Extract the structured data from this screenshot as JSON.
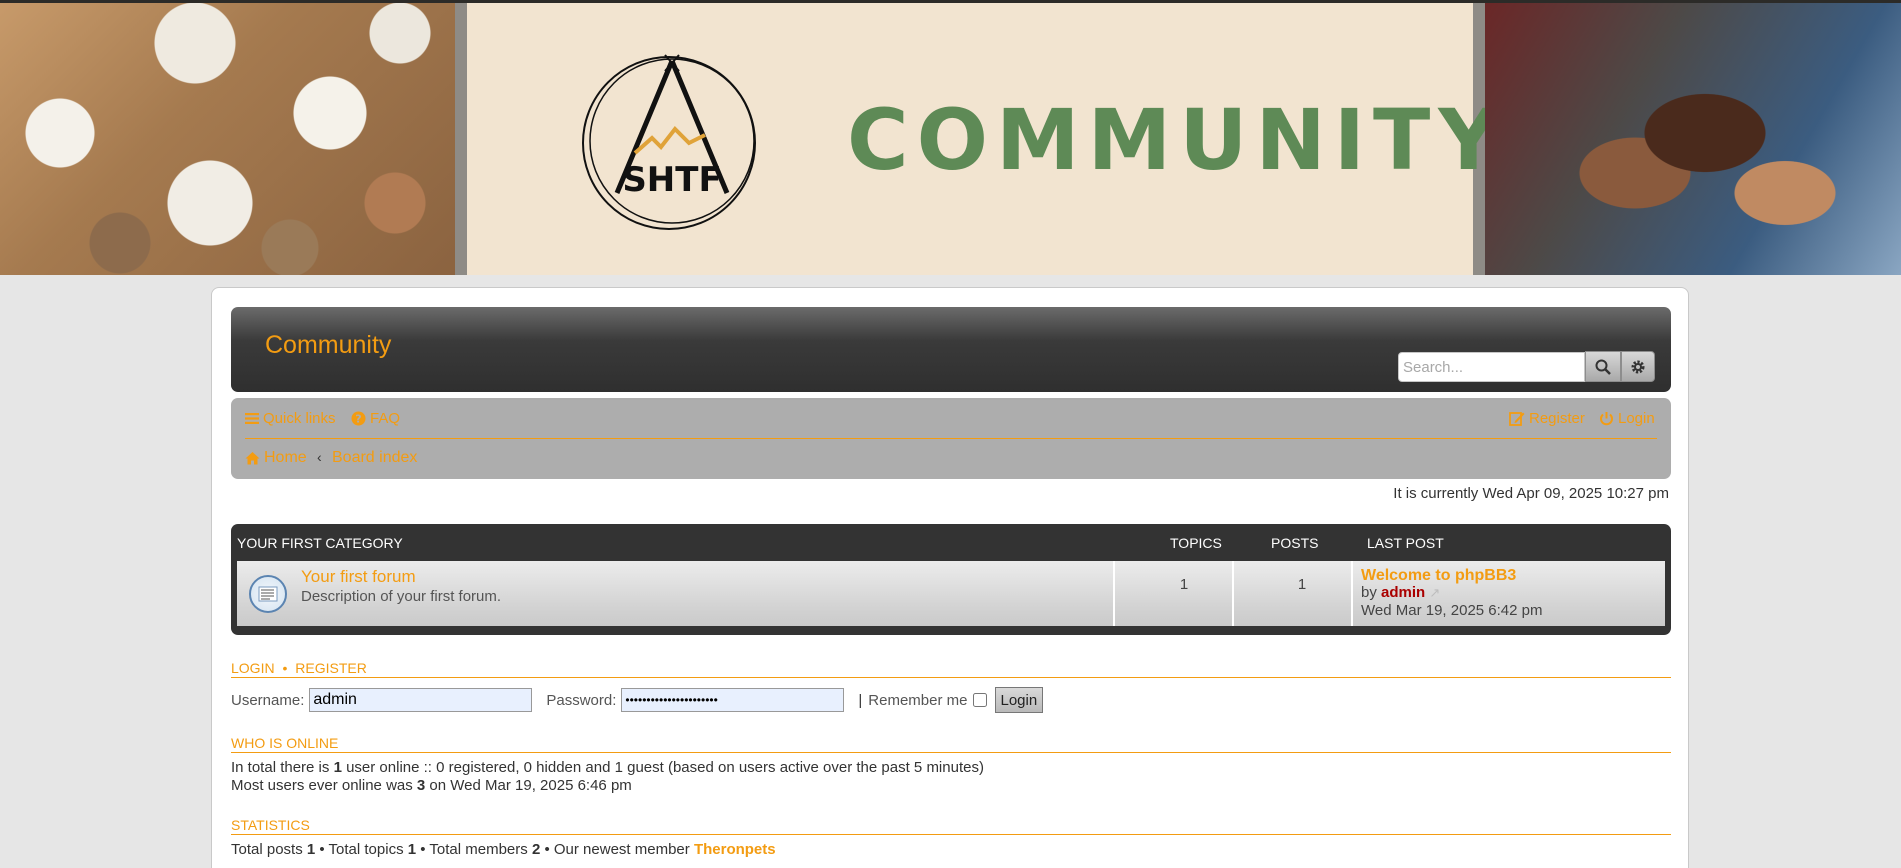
{
  "banner": {
    "word": "COMMUNITY",
    "logo_text": "SHTF"
  },
  "header": {
    "site_title": "Community",
    "search_placeholder": "Search..."
  },
  "nav": {
    "quick_links": "Quick links",
    "faq": "FAQ",
    "register": "Register",
    "login": "Login",
    "home": "Home",
    "board_index": "Board index"
  },
  "timestamp": "It is currently Wed Apr 09, 2025 10:27 pm",
  "forum_table": {
    "category": "YOUR FIRST CATEGORY",
    "col_topics": "TOPICS",
    "col_posts": "POSTS",
    "col_last_post": "LAST POST",
    "rows": [
      {
        "title": "Your first forum",
        "description": "Description of your first forum.",
        "topics": "1",
        "posts": "1",
        "last_post_title": "Welcome to phpBB3",
        "last_post_by": "by",
        "last_post_author": "admin",
        "last_post_date": "Wed Mar 19, 2025 6:42 pm"
      }
    ]
  },
  "login": {
    "heading_login": "LOGIN",
    "heading_sep": "•",
    "heading_register": "REGISTER",
    "username_label": "Username:",
    "username_value": "admin",
    "password_label": "Password:",
    "password_value": "••••••••••••••••••••••",
    "remember_label": "Remember me",
    "button": "Login"
  },
  "online": {
    "heading": "WHO IS ONLINE",
    "line1_pre": "In total there is ",
    "line1_count": "1",
    "line1_post": " user online :: 0 registered, 0 hidden and 1 guest (based on users active over the past 5 minutes)",
    "line2_pre": "Most users ever online was ",
    "line2_count": "3",
    "line2_post": " on Wed Mar 19, 2025 6:46 pm"
  },
  "stats": {
    "heading": "STATISTICS",
    "posts_label": "Total posts ",
    "posts": "1",
    "topics_label": " • Total topics ",
    "topics": "1",
    "members_label": " • Total members ",
    "members": "2",
    "newest_label": " • Our newest member ",
    "newest": "Theronpets"
  },
  "colors": {
    "accent": "#f39c12",
    "author": "#aa0000",
    "banner_word": "#5e8a56"
  }
}
